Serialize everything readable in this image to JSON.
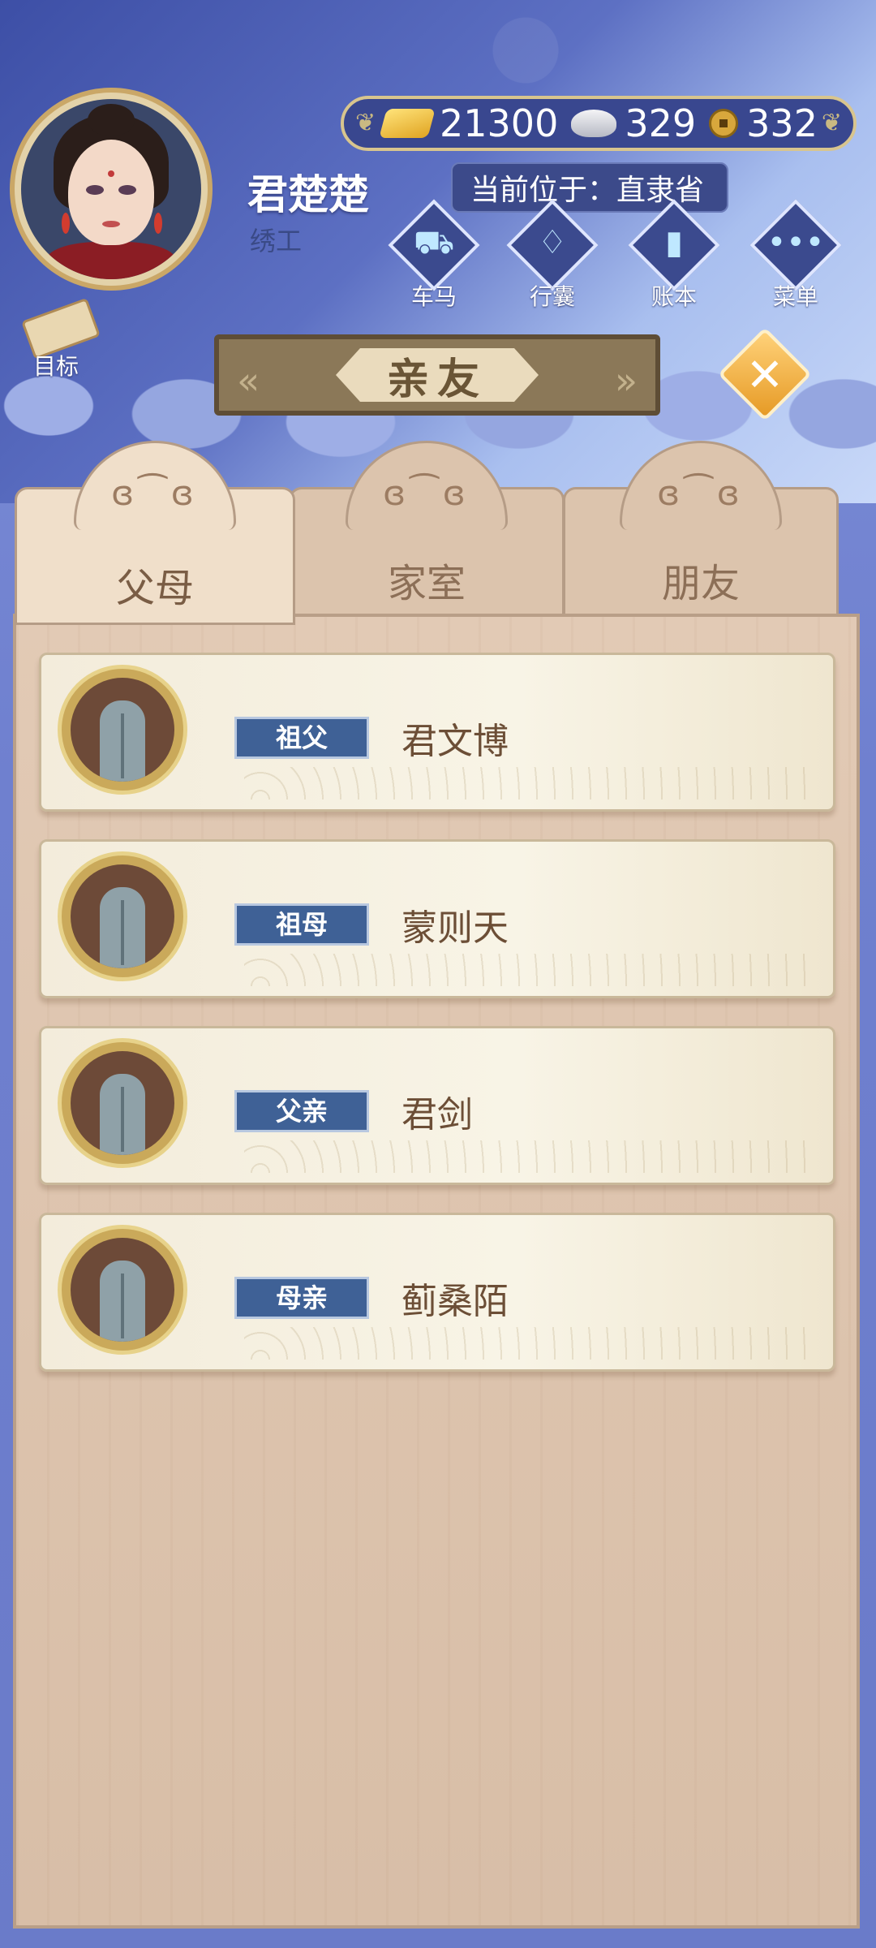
{
  "player": {
    "name": "君楚楚",
    "title": "绣工",
    "location": "当前位于：直隶省"
  },
  "currency": {
    "gold": "21300",
    "silver": "329",
    "coin": "332"
  },
  "menu": [
    {
      "label": "车马",
      "icon": "carriage-icon"
    },
    {
      "label": "行囊",
      "icon": "bag-icon"
    },
    {
      "label": "账本",
      "icon": "ledger-icon"
    },
    {
      "label": "菜单",
      "icon": "more-icon"
    }
  ],
  "goal": {
    "label": "目标"
  },
  "panel": {
    "title": "亲友"
  },
  "tabs": [
    {
      "label": "父母",
      "active": true
    },
    {
      "label": "家室",
      "active": false
    },
    {
      "label": "朋友",
      "active": false
    }
  ],
  "relatives": [
    {
      "relation": "祖父",
      "name": "君文博"
    },
    {
      "relation": "祖母",
      "name": "蒙则天"
    },
    {
      "relation": "父亲",
      "name": "君剑"
    },
    {
      "relation": "母亲",
      "name": "蓟桑陌"
    }
  ]
}
